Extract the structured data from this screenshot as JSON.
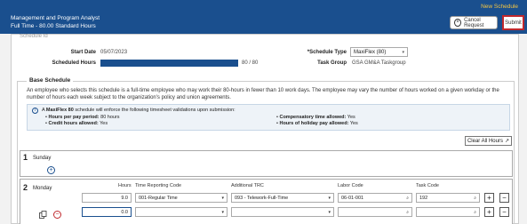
{
  "header": {
    "title": "Management and Program Analyst",
    "subtitle": "Full Time - 80.00  Standard Hours",
    "new_schedule": "New Schedule",
    "cancel_label": "Cancel Request",
    "submit_label": "Submit"
  },
  "form": {
    "schedule_id_label": "Schedule Id",
    "start_date_label": "Start Date",
    "start_date_value": "05/07/2023",
    "scheduled_hours_label": "Scheduled Hours",
    "scheduled_hours_value": "80 / 80",
    "scheduled_hours_progress": 1.0,
    "schedule_type_label": "*Schedule Type",
    "schedule_type_value": "MaxiFlex (80)",
    "task_group_label": "Task Group",
    "task_group_value": "GSA GM&A Taskgroup"
  },
  "base_schedule": {
    "title": "Base Schedule",
    "description": "An employee who selects this schedule is a full-time employee who may work their 80-hours in fewer than 10 work days. The employee may vary the number of hours worked on a given workday or the number of hours each week subject to the organization's policy and union agreements.",
    "info_prefix": "A ",
    "info_bold": "MaxiFlex 80",
    "info_suffix": " schedule will enforce the following timesheet validations upon submission:",
    "rules": [
      {
        "label": "Hours per pay period:",
        "value": " 80 hours"
      },
      {
        "label": "Credit hours allowed:",
        "value": " Yes"
      },
      {
        "label": "Compensatory time allowed:",
        "value": " Yes"
      },
      {
        "label": "Hours of holiday pay allowed:",
        "value": " Yes"
      }
    ],
    "clear_label": "Clear All Hours"
  },
  "days": [
    {
      "num": "1",
      "name": "Sunday"
    },
    {
      "num": "2",
      "name": "Monday"
    }
  ],
  "columns": {
    "hours": "Hours",
    "trc": "Time Reporting Code",
    "additional_trc": "Additional TRC",
    "labor_code": "Labor Code",
    "task_code": "Task Code"
  },
  "rows": [
    {
      "hours": "9.0",
      "trc": "001-Regular Time",
      "additional_trc": "093 - Telework-Full-Time",
      "labor_code": "06-01-001",
      "task_code": "192"
    },
    {
      "hours": "0.0",
      "trc": "",
      "additional_trc": "",
      "labor_code": "",
      "task_code": ""
    }
  ],
  "colors": {
    "header_bg": "#1a4f8e",
    "accent": "#f5c542",
    "danger": "#c0282d"
  }
}
